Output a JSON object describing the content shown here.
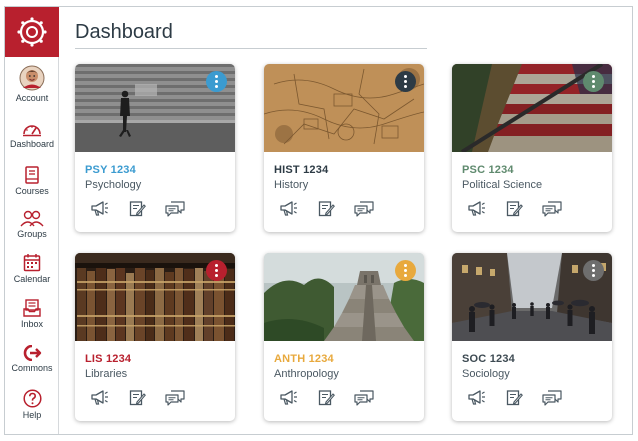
{
  "header": {
    "title": "Dashboard"
  },
  "nav": {
    "items": [
      {
        "key": "account",
        "label": "Account",
        "icon": "account-avatar-icon"
      },
      {
        "key": "dashboard",
        "label": "Dashboard",
        "icon": "dashboard-gauge-icon"
      },
      {
        "key": "courses",
        "label": "Courses",
        "icon": "book-icon"
      },
      {
        "key": "groups",
        "label": "Groups",
        "icon": "people-icon"
      },
      {
        "key": "calendar",
        "label": "Calendar",
        "icon": "calendar-icon"
      },
      {
        "key": "inbox",
        "label": "Inbox",
        "icon": "inbox-icon"
      },
      {
        "key": "commons",
        "label": "Commons",
        "icon": "commons-arrow-icon"
      },
      {
        "key": "help",
        "label": "Help",
        "icon": "help-question-icon"
      }
    ],
    "brand_color": "#b8202e"
  },
  "courses": [
    {
      "code": "PSY 1234",
      "name": "Psychology",
      "color": "#3b9bd0",
      "image": "person walking past a striped wall"
    },
    {
      "code": "HIST 1234",
      "name": "History",
      "color": "#2d3b45",
      "image": "old parchment map"
    },
    {
      "code": "PSC 1234",
      "name": "Political Science",
      "color": "#5f8a6e",
      "image": "worn painted flag"
    },
    {
      "code": "LIS 1234",
      "name": "Libraries",
      "color": "#b8202e",
      "image": "shelf of old leather books"
    },
    {
      "code": "ANTH 1234",
      "name": "Anthropology",
      "color": "#e8a93d",
      "image": "stepped stone pyramid in jungle"
    },
    {
      "code": "SOC 1234",
      "name": "Sociology",
      "color": "#3d4a52",
      "image": "crowded city street in rain"
    }
  ],
  "card_actions": [
    "announcements-icon",
    "assignments-icon",
    "discussions-icon"
  ]
}
